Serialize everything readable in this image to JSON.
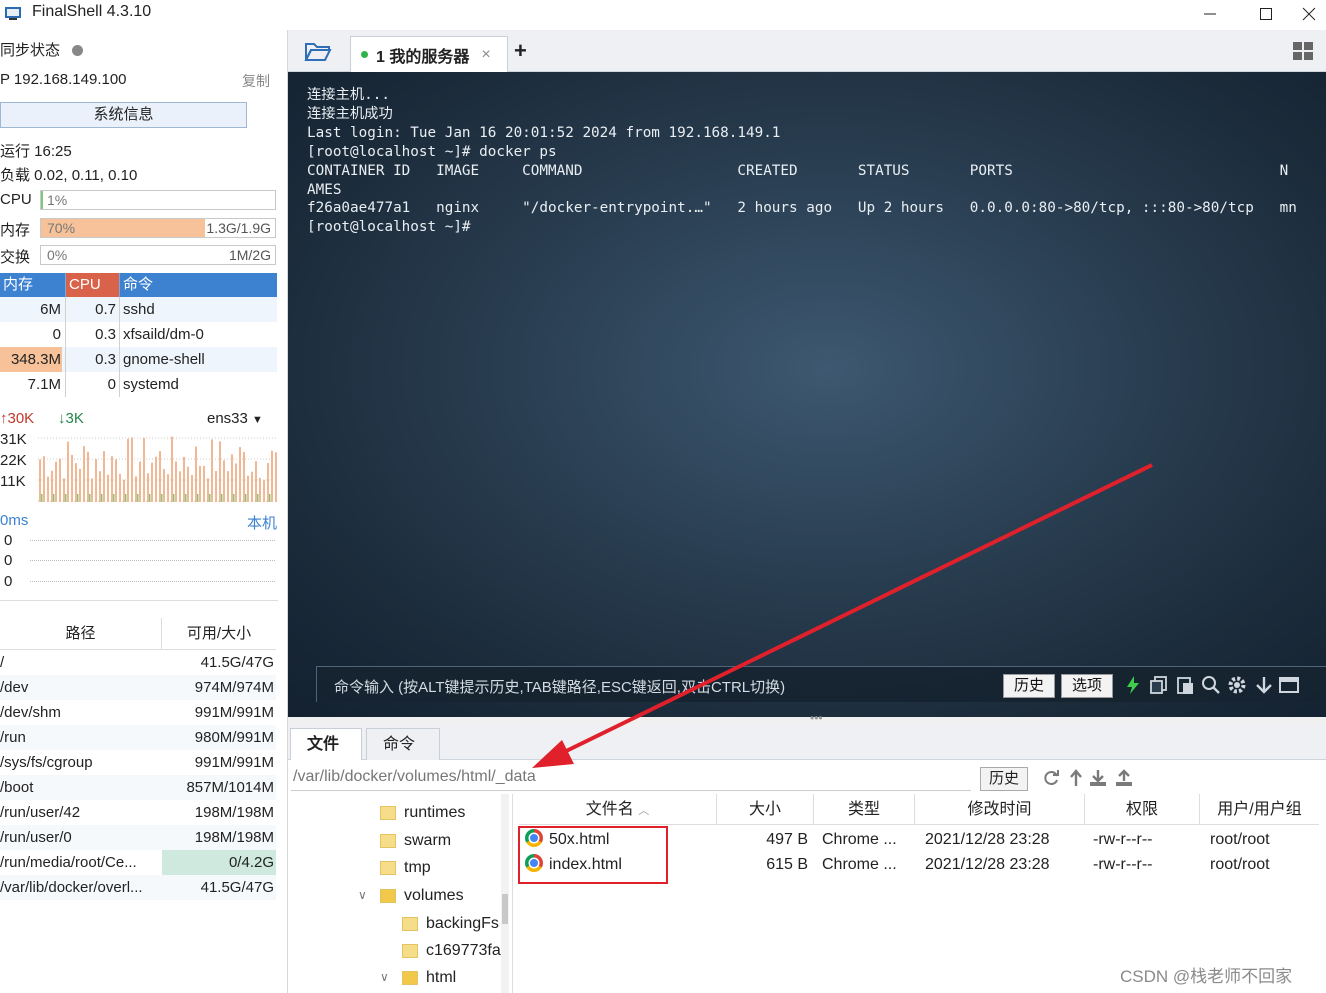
{
  "window": {
    "title": "FinalShell 4.3.10"
  },
  "left": {
    "sync_label": "同步状态",
    "ip": "P  192.168.149.100",
    "copy": "复制",
    "sysinfo_button": "系统信息",
    "uptime": "运行 16:25",
    "load": "负载 0.02, 0.11, 0.10",
    "cpu": {
      "label": "CPU",
      "pct": "1%",
      "fill": 0.01
    },
    "mem": {
      "label": "内存",
      "pct": "70%",
      "amount": "1.3G/1.9G",
      "fill": 0.7
    },
    "swap": {
      "label": "交换",
      "pct": "0%",
      "amount": "1M/2G",
      "fill": 0.0
    },
    "proc_headers": [
      "内存",
      "CPU",
      "命令"
    ],
    "processes": [
      {
        "mem": "6M",
        "cpu": "0.7",
        "cmd": "sshd"
      },
      {
        "mem": "0",
        "cpu": "0.3",
        "cmd": "xfsaild/dm-0"
      },
      {
        "mem": "348.3M",
        "cpu": "0.3",
        "cmd": "gnome-shell"
      },
      {
        "mem": "7.1M",
        "cpu": "0",
        "cmd": "systemd"
      }
    ],
    "net": {
      "up": "30K",
      "down": "3K",
      "iface": "ens33",
      "scale": [
        "31K",
        "22K",
        "11K"
      ]
    },
    "ping": {
      "latency": "0ms",
      "host": "本机",
      "values": [
        "0",
        "0",
        "0"
      ]
    },
    "disk_headers": [
      "路径",
      "可用/大小"
    ],
    "disks": [
      {
        "path": "/",
        "size": "41.5G/47G"
      },
      {
        "path": "/dev",
        "size": "974M/974M"
      },
      {
        "path": "/dev/shm",
        "size": "991M/991M"
      },
      {
        "path": "/run",
        "size": "980M/991M"
      },
      {
        "path": "/sys/fs/cgroup",
        "size": "991M/991M"
      },
      {
        "path": "/boot",
        "size": "857M/1014M"
      },
      {
        "path": "/run/user/42",
        "size": "198M/198M"
      },
      {
        "path": "/run/user/0",
        "size": "198M/198M"
      },
      {
        "path": "/run/media/root/Ce...",
        "size": "0/4.2G"
      },
      {
        "path": "/var/lib/docker/overl...",
        "size": "41.5G/47G"
      }
    ]
  },
  "tabs": {
    "session": "1 我的服务器",
    "close": "×",
    "add": "+"
  },
  "terminal": {
    "lines": [
      "连接主机...",
      "连接主机成功",
      "Last login: Tue Jan 16 20:01:52 2024 from 192.168.149.1",
      "[root@localhost ~]# docker ps",
      "CONTAINER ID   IMAGE     COMMAND                  CREATED       STATUS       PORTS                               N",
      "AMES",
      "f26a0ae477a1   nginx     \"/docker-entrypoint.…\"   2 hours ago   Up 2 hours   0.0.0.0:80->80/tcp, :::80->80/tcp   mn",
      "[root@localhost ~]#"
    ],
    "cmd_placeholder": "命令输入 (按ALT键提示历史,TAB键路径,ESC键返回,双击CTRL切换)",
    "history_button": "历史",
    "options_button": "选项"
  },
  "filepanel": {
    "tab_files": "文件",
    "tab_commands": "命令",
    "path": "/var/lib/docker/volumes/html/_data",
    "history_button": "历史",
    "tree": [
      "runtimes",
      "swarm",
      "tmp",
      "volumes",
      "backingFs",
      "c169773fa",
      "html"
    ],
    "headers": [
      "文件名",
      "大小",
      "类型",
      "修改时间",
      "权限",
      "用户/用户组"
    ],
    "files": [
      {
        "name": "50x.html",
        "size": "497 B",
        "type": "Chrome ...",
        "mtime": "2021/12/28 23:28",
        "perm": "-rw-r--r--",
        "owner": "root/root"
      },
      {
        "name": "index.html",
        "size": "615 B",
        "type": "Chrome ...",
        "mtime": "2021/12/28 23:28",
        "perm": "-rw-r--r--",
        "owner": "root/root"
      }
    ]
  },
  "watermark": "CSDN @栈老师不回家",
  "colors": {
    "accent": "#3c82d0",
    "mem_fill": "#f7c29a",
    "annotation": "#e0212b"
  }
}
